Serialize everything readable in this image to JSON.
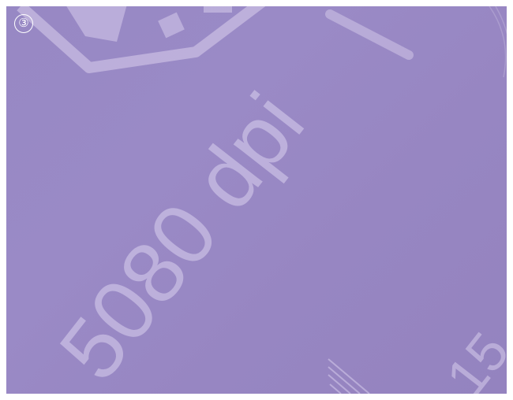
{
  "badge": {
    "label": "③"
  },
  "photo": {
    "main_text": "5080 dpi",
    "corner_text": "15",
    "background_color": "#9788c4",
    "print_color": "#c5b9e0"
  }
}
